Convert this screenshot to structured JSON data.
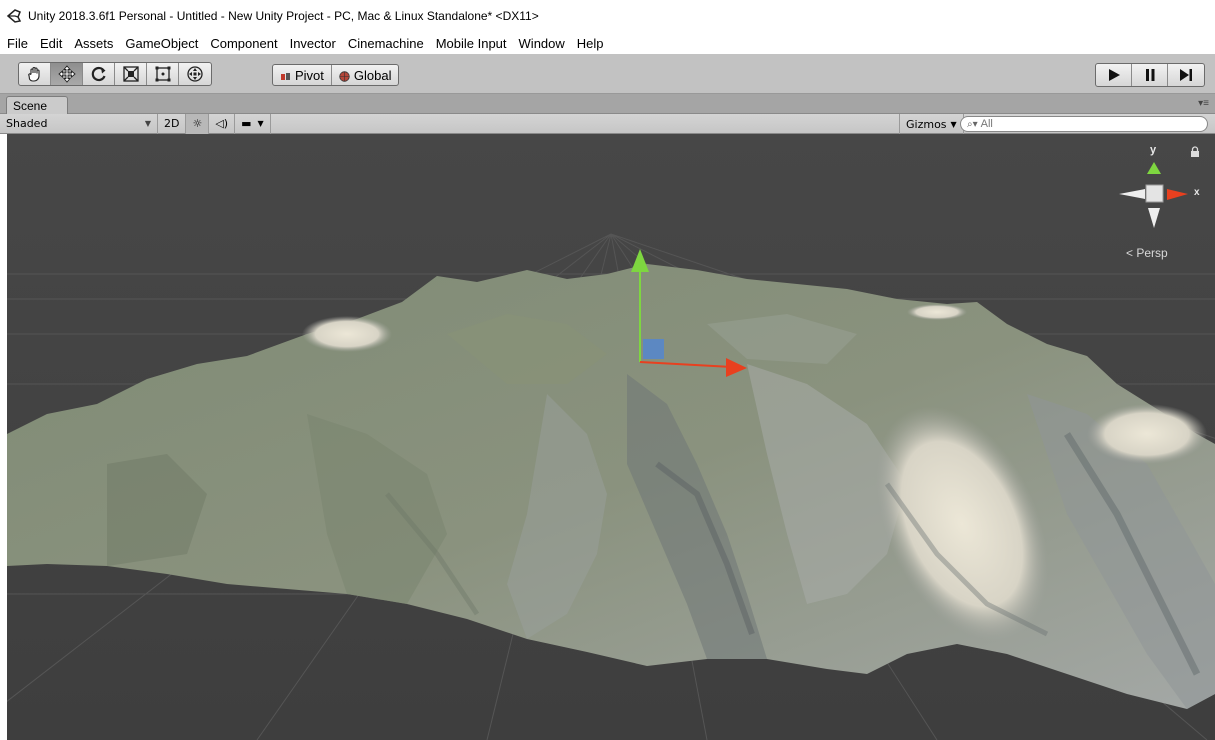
{
  "window": {
    "title": "Unity 2018.3.6f1 Personal - Untitled - New Unity Project - PC, Mac & Linux Standalone* <DX11>"
  },
  "menu": {
    "items": [
      "File",
      "Edit",
      "Assets",
      "GameObject",
      "Component",
      "Invector",
      "Cinemachine",
      "Mobile Input",
      "Window",
      "Help"
    ]
  },
  "toolbar": {
    "tools": [
      "hand-tool",
      "move-tool",
      "rotate-tool",
      "scale-tool",
      "rect-tool",
      "transform-tool"
    ],
    "active_tool": "move-tool",
    "pivot_label": "Pivot",
    "global_label": "Global",
    "play_controls": [
      "play",
      "pause",
      "step"
    ]
  },
  "scene_panel": {
    "tab_label": "Scene",
    "shading_mode": "Shaded",
    "mode_2d_label": "2D",
    "gizmos_label": "Gizmos",
    "search_placeholder": "All",
    "projection_label": "Persp",
    "axis_labels": {
      "y": "y",
      "x": "x"
    }
  },
  "colors": {
    "viewport_bg": "#464646",
    "terrain_green": "#7d8a6c",
    "terrain_rock": "#9aa0a4",
    "snow": "#e6e1d1",
    "axis_y": "#7ed640",
    "axis_x": "#e8401f",
    "axis_z": "#4d86d9"
  }
}
